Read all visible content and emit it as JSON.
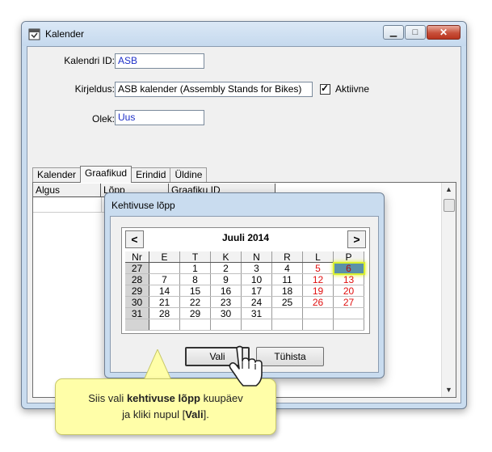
{
  "window": {
    "title": "Kalender",
    "icon": "calendar-app-icon"
  },
  "form": {
    "kalendri_id_label": "Kalendri ID:",
    "kalendri_id_value": "ASB",
    "kirjeldus_label": "Kirjeldus:",
    "kirjeldus_value": "ASB kalender (Assembly Stands for Bikes)",
    "aktiivne_label": "Aktiivne",
    "aktiivne_checked": true,
    "olek_label": "Olek:",
    "olek_value": "Uus"
  },
  "tabs": [
    {
      "label": "Kalender",
      "active": false
    },
    {
      "label": "Graafikud",
      "active": true
    },
    {
      "label": "Erindid",
      "active": false
    },
    {
      "label": "Üldine",
      "active": false
    }
  ],
  "grid": {
    "columns": [
      "Algus",
      "Lõpp",
      "Graafiku ID"
    ]
  },
  "dialog": {
    "title": "Kehtivuse lõpp",
    "month": "Juuli 2014",
    "prev": "<",
    "next": ">",
    "headers": [
      "Nr",
      "E",
      "T",
      "K",
      "N",
      "R",
      "L",
      "P"
    ],
    "weeks": [
      [
        "27",
        "",
        "1",
        "2",
        "3",
        "4",
        "5",
        "6"
      ],
      [
        "28",
        "7",
        "8",
        "9",
        "10",
        "11",
        "12",
        "13"
      ],
      [
        "29",
        "14",
        "15",
        "16",
        "17",
        "18",
        "19",
        "20"
      ],
      [
        "30",
        "21",
        "22",
        "23",
        "24",
        "25",
        "26",
        "27"
      ],
      [
        "31",
        "28",
        "29",
        "30",
        "31",
        "",
        "",
        ""
      ],
      [
        "",
        "",
        "",
        "",
        "",
        "",
        "",
        ""
      ]
    ],
    "selected_day": "6",
    "ok_label": "Vali",
    "cancel_label": "Tühista"
  },
  "callout": {
    "part1": "Siis vali ",
    "bold1": "kehtivuse lõpp",
    "part2": " kuupäev",
    "part3": "ja kliki nupul [",
    "bold2": "Vali",
    "part4": "]."
  },
  "colors": {
    "weekend": "#e01010",
    "selected_bg": "#5b91a8",
    "highlight": "#d8ef30",
    "callout_bg": "#fffea8"
  }
}
